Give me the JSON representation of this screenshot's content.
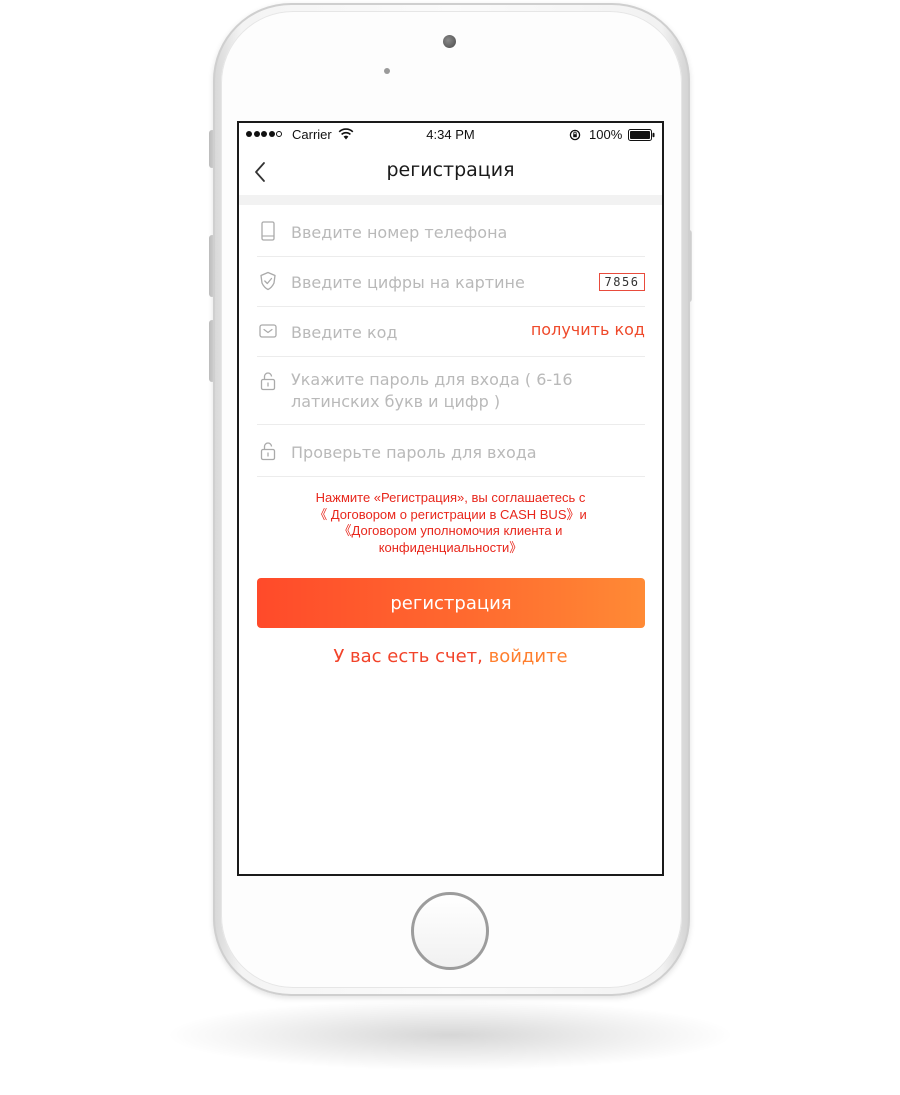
{
  "status_bar": {
    "carrier": "Carrier",
    "time": "4:34 PM",
    "battery_percent": "100%",
    "signal_bars_filled": 4,
    "signal_bars_total": 5
  },
  "nav": {
    "title": "регистрация",
    "back_icon": "chevron-left-icon"
  },
  "form": {
    "phone": {
      "icon": "phone-icon",
      "placeholder": "Введите номер телефона"
    },
    "captcha": {
      "icon": "shield-check-icon",
      "placeholder": "Введите цифры на картине",
      "captcha_digits": "7856"
    },
    "sms_code": {
      "icon": "message-code-icon",
      "placeholder": "Введите код",
      "get_code_label": "получить код"
    },
    "password": {
      "icon": "lock-icon",
      "placeholder": "Укажите пароль для входа ( 6-16 латинских букв и цифр )"
    },
    "password_confirm": {
      "icon": "lock-icon",
      "placeholder": "Проверьте пароль для входа"
    }
  },
  "agreement": {
    "line1": "Нажмите «Регистрация», вы соглашаетесь с",
    "line2": "《 Договором о регистрации в CASH BUS》и",
    "line3": "《Договором  уполномочия клиента и",
    "line4": "конфиденциальности》"
  },
  "register_button_label": "регистрация",
  "login_prompt": {
    "question": "У вас есть счет,",
    "link": " войдите"
  },
  "colors": {
    "accent": "#ef4a2b",
    "button_start": "#ff4a2a",
    "button_end": "#ff8a35",
    "agreement_text": "#e8271c",
    "placeholder": "#b9b9b9"
  }
}
